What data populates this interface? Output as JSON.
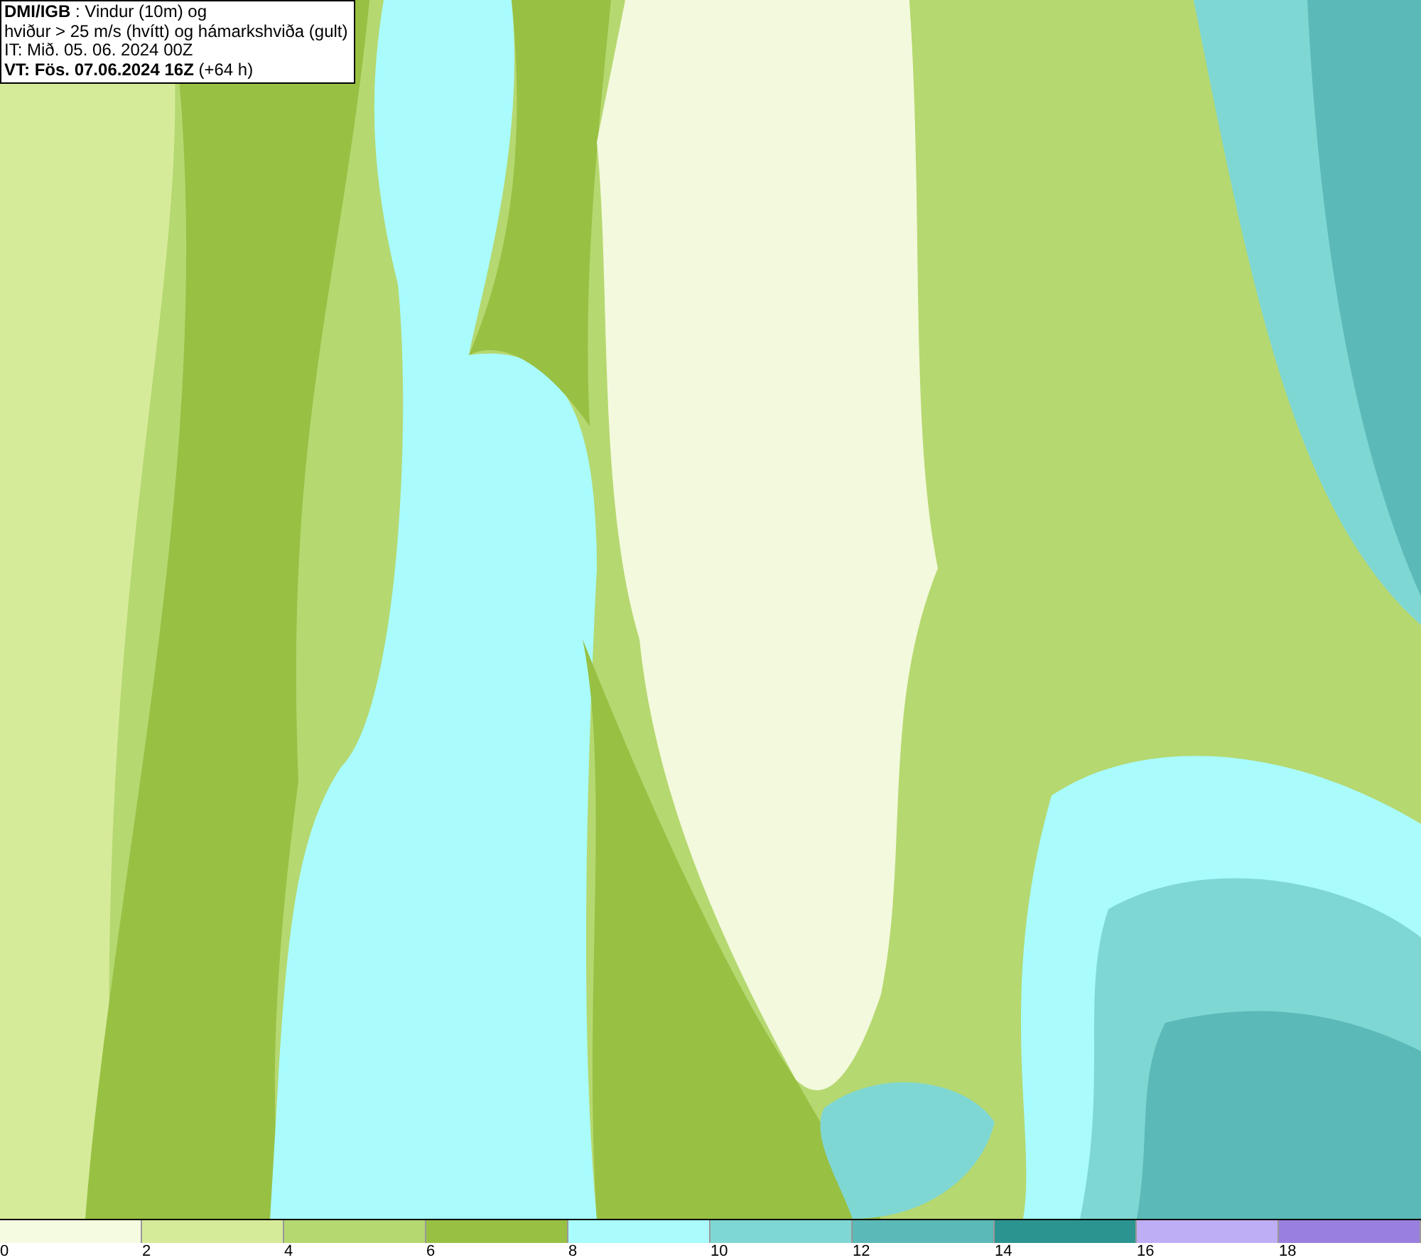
{
  "title_box": {
    "lines": [
      "**DMI/IGB** : Vindur (10m) og",
      "hviður > 25 m/s (hvítt) og hámarkshviða (gult)",
      "IT: Mið. 05. 06. 2024 00Z",
      "**VT: Fös. 07.06.2024 16Z** (+64 h)"
    ]
  },
  "legend": [
    {
      "label": "0",
      "color": "#f5fbe0"
    },
    {
      "label": "2",
      "color": "#d6eb9a"
    },
    {
      "label": "4",
      "color": "#b5d870"
    },
    {
      "label": "6",
      "color": "#98c043"
    },
    {
      "label": "8",
      "color": "#a9fbfc"
    },
    {
      "label": "10",
      "color": "#7fd7d4"
    },
    {
      "label": "12",
      "color": "#5bb9b7"
    },
    {
      "label": "14",
      "color": "#2c9490"
    },
    {
      "label": "16",
      "color": "#bdaef5"
    },
    {
      "label": "18",
      "color": "#9980e0"
    }
  ]
}
